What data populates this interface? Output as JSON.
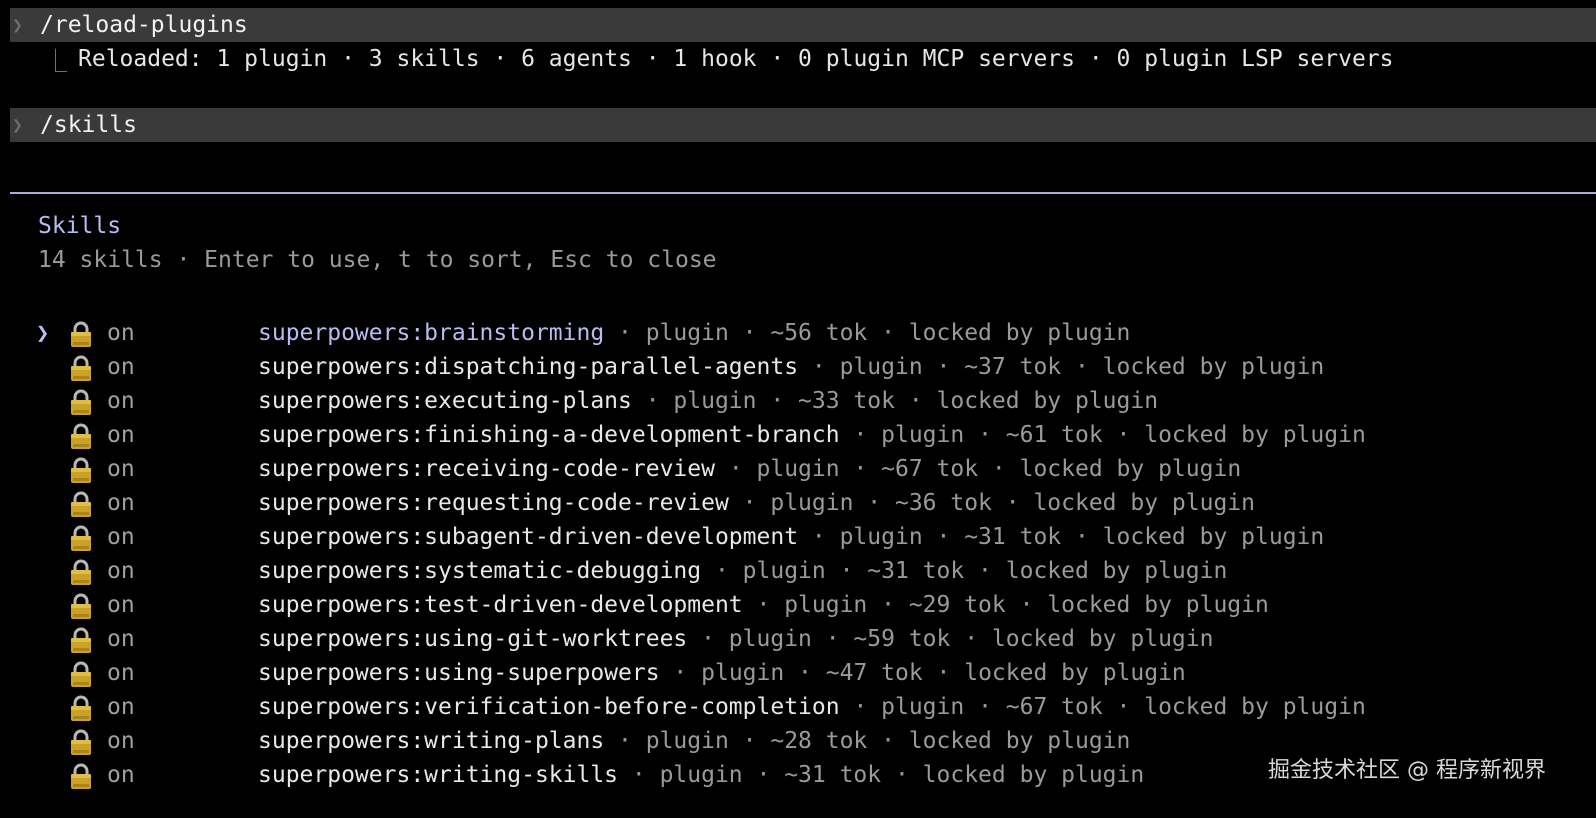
{
  "terminal": {
    "commands": [
      {
        "text": "/reload-plugins",
        "result": "Reloaded: 1 plugin · 3 skills · 6 agents · 1 hook · 0 plugin MCP servers · 0 plugin LSP servers"
      },
      {
        "text": "/skills"
      }
    ],
    "prompt_glyph": "❯",
    "result_glyph": "⎿"
  },
  "skills_panel": {
    "title": "Skills",
    "subtitle": "14 skills · Enter to use, t to sort, Esc to close",
    "selected_index": 0,
    "cursor_glyph": "❯",
    "items": [
      {
        "name": "superpowers:brainstorming",
        "state": "on",
        "meta": " · plugin · ~56 tok · locked by plugin"
      },
      {
        "name": "superpowers:dispatching-parallel-agents",
        "state": "on",
        "meta": " · plugin · ~37 tok · locked by plugin"
      },
      {
        "name": "superpowers:executing-plans",
        "state": "on",
        "meta": " · plugin · ~33 tok · locked by plugin"
      },
      {
        "name": "superpowers:finishing-a-development-branch",
        "state": "on",
        "meta": " · plugin · ~61 tok · locked by plugin"
      },
      {
        "name": "superpowers:receiving-code-review",
        "state": "on",
        "meta": " · plugin · ~67 tok · locked by plugin"
      },
      {
        "name": "superpowers:requesting-code-review",
        "state": "on",
        "meta": " · plugin · ~36 tok · locked by plugin"
      },
      {
        "name": "superpowers:subagent-driven-development",
        "state": "on",
        "meta": " · plugin · ~31 tok · locked by plugin"
      },
      {
        "name": "superpowers:systematic-debugging",
        "state": "on",
        "meta": " · plugin · ~31 tok · locked by plugin"
      },
      {
        "name": "superpowers:test-driven-development",
        "state": "on",
        "meta": " · plugin · ~29 tok · locked by plugin"
      },
      {
        "name": "superpowers:using-git-worktrees",
        "state": "on",
        "meta": " · plugin · ~59 tok · locked by plugin"
      },
      {
        "name": "superpowers:using-superpowers",
        "state": "on",
        "meta": " · plugin · ~47 tok · locked by plugin"
      },
      {
        "name": "superpowers:verification-before-completion",
        "state": "on",
        "meta": " · plugin · ~67 tok · locked by plugin"
      },
      {
        "name": "superpowers:writing-plans",
        "state": "on",
        "meta": " · plugin · ~28 tok · locked by plugin"
      },
      {
        "name": "superpowers:writing-skills",
        "state": "on",
        "meta": " · plugin · ~31 tok · locked by plugin"
      }
    ],
    "icon": "lock-icon"
  },
  "watermark": "掘金技术社区 @ 程序新视界",
  "colors": {
    "background": "#000000",
    "command_bar": "#3a3a3a",
    "accent": "#b9bcf2",
    "divider": "#a8acd8",
    "muted_text": "#9a9a9a",
    "lock_gold": "#c9a227"
  }
}
